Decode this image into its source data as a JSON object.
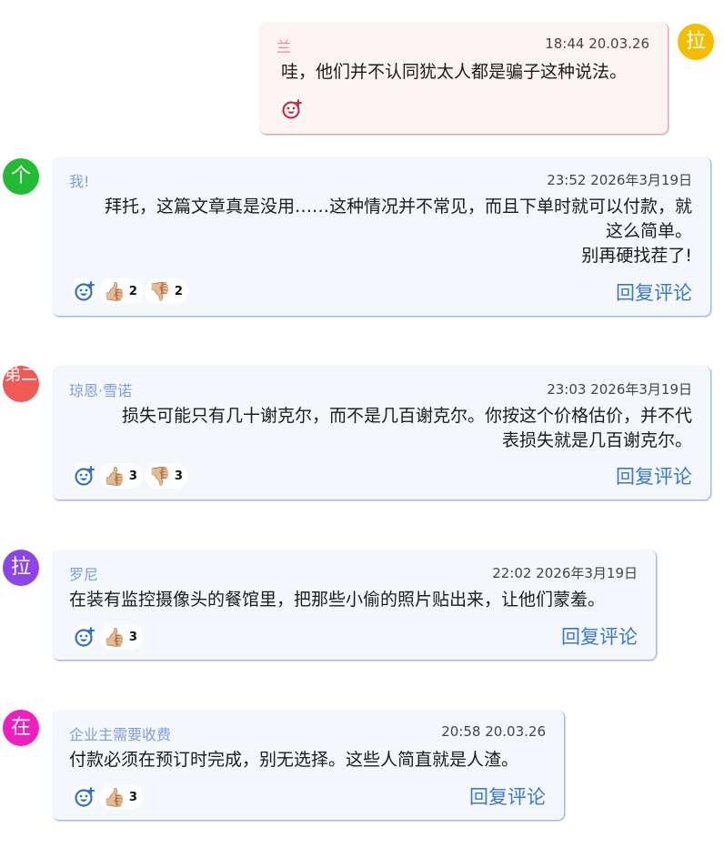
{
  "comments": [
    {
      "avatar_char": "拉",
      "avatar_color": "#f5bd00",
      "author": "兰",
      "time": "18:44 20.03.26",
      "lines": [
        "哇，他们并不认同犹太人都是骗子这种说法。"
      ]
    },
    {
      "avatar_char": "个",
      "avatar_color": "#22bb33",
      "author": "我!",
      "time": "23:52 2026年3月19日",
      "lines": [
        "拜托，这篇文章真是没用……这种情况并不常见，而且下单时就可以付款，就",
        "这么简单。",
        "别再硬找茬了!"
      ],
      "likes": "2",
      "dislikes": "2",
      "reply_label": "回复评论"
    },
    {
      "avatar_char": "弟二",
      "avatar_color": "#ef5a55",
      "author": "琼恩·雪诺",
      "time": "23:03 2026年3月19日",
      "lines": [
        "损失可能只有几十谢克尔，而不是几百谢克尔。你按这个价格估价，并不代",
        "表损失就是几百谢克尔。"
      ],
      "likes": "3",
      "dislikes": "3",
      "reply_label": "回复评论"
    },
    {
      "avatar_char": "拉",
      "avatar_color": "#8b44e6",
      "author": "罗尼",
      "time": "22:02 2026年3月19日",
      "lines": [
        "在装有监控摄像头的餐馆里，把那些小偷的照片贴出来，让他们蒙羞。"
      ],
      "likes": "3",
      "reply_label": "回复评论"
    },
    {
      "avatar_char": "在",
      "avatar_color": "#ee1fbf",
      "author": "企业主需要收费",
      "time": "20:58 20.03.26",
      "lines": [
        "付款必须在预订时完成，别无选择。这些人简直就是人渣。"
      ],
      "likes": "3",
      "reply_label": "回复评论"
    }
  ],
  "icons": {
    "add_reaction": "add-reaction-icon",
    "like": "thumbs-up-icon",
    "dislike": "thumbs-down-icon",
    "like_glyph": "👍🏼",
    "dislike_glyph": "👎🏼"
  }
}
